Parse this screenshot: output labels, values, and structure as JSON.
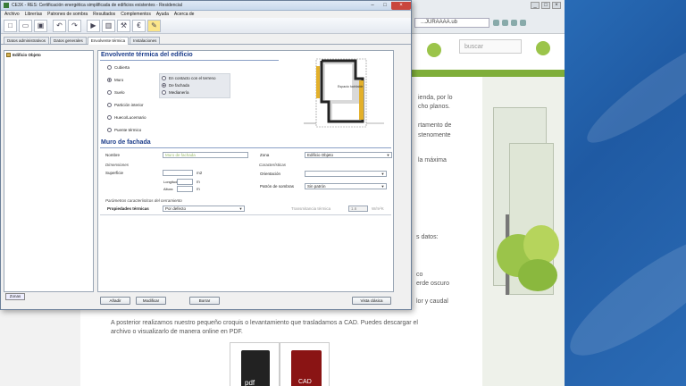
{
  "browser": {
    "url": "...JURAAAA.ub",
    "search_placeholder": "buscar",
    "page_texts": [
      "ienda, por lo",
      "cho planos.",
      "rtamento de",
      "stenomente",
      "la máxima",
      "s datos:",
      "co",
      "erde oscuro",
      "lor y caudal",
      "A posterior realizamos nuestro pequeño croquis o levantamiento que trasladamos a CAD. Puedes descargar el",
      "archivo o visualizarlo de manera online en PDF."
    ],
    "doc_tiles": [
      "pdf",
      "CAD"
    ]
  },
  "app": {
    "title": "CE3X - RES: Certificación energética simplificada de edificios existentes - Residencial",
    "menu": [
      "Archivo",
      "Librerías",
      "Patrones de sombra",
      "Resultados",
      "Complementos",
      "Ayuda",
      "Acerca de"
    ],
    "tabs": [
      "Datos administrativos",
      "Datos generales",
      "Envolvente térmica",
      "Instalaciones"
    ],
    "active_tab_index": 2,
    "tree": {
      "root_label": "Edificio Objeto"
    },
    "zonas_label": "Zonas",
    "envolvente": {
      "title": "Envolvente térmica del edificio",
      "options": [
        "Cubierta",
        "Muro",
        "Suelo",
        "Partición interior",
        "Hueco/Lucernario",
        "Puente térmico"
      ],
      "selected": "Muro",
      "muro_sub": [
        "En contacto con el terreno",
        "De fachada",
        "Medianería"
      ],
      "muro_sub_selected": "De fachada",
      "diagram_label": "Espacio habitable"
    },
    "muro": {
      "title": "Muro de fachada",
      "nombre_label": "Nombre",
      "nombre_value": "Muro de fachada",
      "zona_label": "Zona",
      "zona_value": "Edificio Objeto",
      "dimensiones_label": "Dimensiones",
      "superficie_label": "Superficie",
      "superficie_unit": "m2",
      "longitud_label": "Longitud",
      "longitud_unit": "m",
      "altura_label": "Altura",
      "altura_unit": "m",
      "caracteristicas_label": "Características",
      "orientacion_label": "Orientación",
      "orientacion_value": "",
      "patron_label": "Patrón de sombras",
      "patron_value": "Sin patrón",
      "parametros_label": "Parámetros característicos del cerramiento",
      "propiedades_label": "Propiedades térmicas",
      "propiedades_value": "Por defecto",
      "transmitancia_label": "Transmitancia térmica",
      "transmitancia_value": "1.6",
      "transmitancia_unit": "W/m²K"
    },
    "buttons": [
      "Añadir",
      "Modificar",
      "Borrar",
      "Vista clásica"
    ]
  },
  "icons": {
    "toolbar": [
      "new-file-icon",
      "open-folder-icon",
      "save-icon",
      "undo-icon",
      "redo-icon",
      "play-icon",
      "building-icon",
      "wrench-icon",
      "euro-icon",
      "note-icon"
    ]
  }
}
